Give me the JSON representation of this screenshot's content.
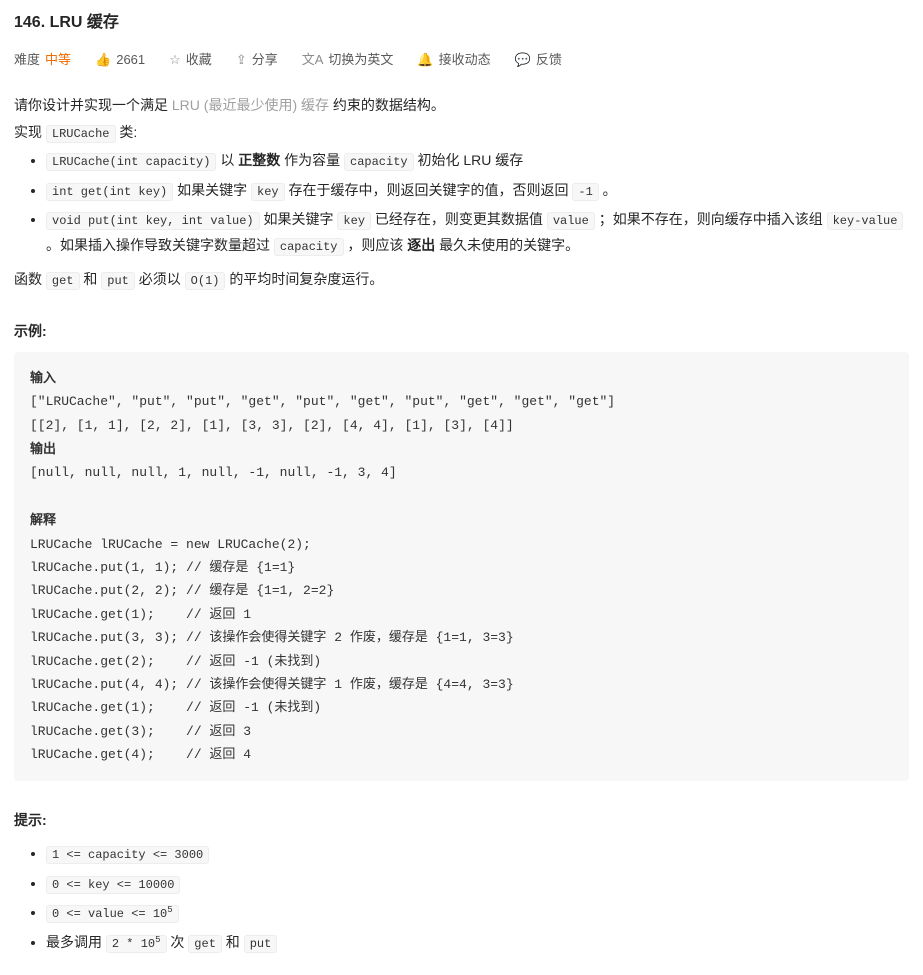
{
  "title": "146. LRU 缓存",
  "meta": {
    "difficulty_label": "难度",
    "difficulty": "中等",
    "likes": "2661",
    "favorite": "收藏",
    "share": "分享",
    "switch_lang": "切换为英文",
    "subscribe": "接收动态",
    "feedback": "反馈"
  },
  "desc": {
    "l1a": "请你设计并实现一个满足 ",
    "l1b": "LRU (最近最少使用) 缓存",
    "l1c": " 约束的数据结构。",
    "l2a": "实现 ",
    "l2code": "LRUCache",
    "l2b": " 类:",
    "b1code": "LRUCache(int capacity)",
    "b1a": " 以 ",
    "b1bold": "正整数",
    "b1b": " 作为容量 ",
    "b1code2": "capacity",
    "b1c": " 初始化 LRU 缓存",
    "b2code": "int get(int key)",
    "b2a": " 如果关键字 ",
    "b2code2": "key",
    "b2b": " 存在于缓存中，则返回关键字的值，否则返回 ",
    "b2code3": "-1",
    "b2c": " 。",
    "b3code": "void put(int key, int value)",
    "b3a": " 如果关键字 ",
    "b3code2": "key",
    "b3b": " 已经存在，则变更其数据值 ",
    "b3code3": "value",
    "b3c": " ；如果不存在，则向缓存中插入该组 ",
    "b3code4": "key-value",
    "b3d": " 。如果插入操作导致关键字数量超过 ",
    "b3code5": "capacity",
    "b3e": " ，则应该 ",
    "b3bold": "逐出",
    "b3f": " 最久未使用的关键字。",
    "l3a": "函数 ",
    "l3code1": "get",
    "l3b": " 和 ",
    "l3code2": "put",
    "l3c": " 必须以 ",
    "l3code3": "O(1)",
    "l3d": " 的平均时间复杂度运行。"
  },
  "example_label": "示例:",
  "example": {
    "input_label": "输入",
    "input_l1": "[\"LRUCache\", \"put\", \"put\", \"get\", \"put\", \"get\", \"put\", \"get\", \"get\", \"get\"]",
    "input_l2": "[[2], [1, 1], [2, 2], [1], [3, 3], [2], [4, 4], [1], [3], [4]]",
    "output_label": "输出",
    "output_l1": "[null, null, null, 1, null, -1, null, -1, 3, 4]",
    "explain_label": "解释",
    "explain_lines": "LRUCache lRUCache = new LRUCache(2);\nlRUCache.put(1, 1); // 缓存是 {1=1}\nlRUCache.put(2, 2); // 缓存是 {1=1, 2=2}\nlRUCache.get(1);    // 返回 1\nlRUCache.put(3, 3); // 该操作会使得关键字 2 作废，缓存是 {1=1, 3=3}\nlRUCache.get(2);    // 返回 -1 (未找到)\nlRUCache.put(4, 4); // 该操作会使得关键字 1 作废，缓存是 {4=4, 3=3}\nlRUCache.get(1);    // 返回 -1 (未找到)\nlRUCache.get(3);    // 返回 3\nlRUCache.get(4);    // 返回 4"
  },
  "hints_label": "提示:",
  "hints": {
    "h1": "1 <= capacity <= 3000",
    "h2": "0 <= key <= 10000",
    "h3a": "0 <= value <= 10",
    "h3b": "5",
    "h4a": "最多调用 ",
    "h4b": "2 * 10",
    "h4c": "5",
    "h4d": " 次 ",
    "h4e": "get",
    "h4f": " 和 ",
    "h4g": "put"
  }
}
